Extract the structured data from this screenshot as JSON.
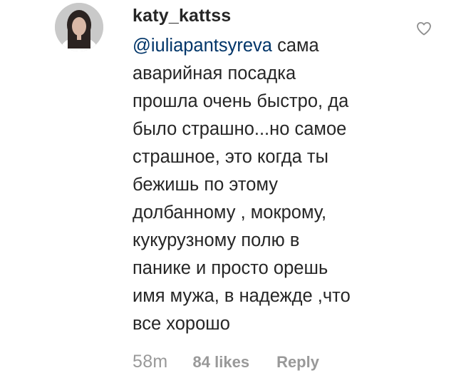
{
  "comment": {
    "username": "katy_kattss",
    "mention": "@iuliapantsyreva",
    "first_line_rest": " сама",
    "lines": [
      "аварийная посадка",
      "прошла очень быстро, да",
      "было страшно...но самое",
      "страшное, это когда ты",
      "бежишь по этому",
      "долбанному , мокрому,",
      "кукурузному полю в",
      "панике и просто орешь",
      "имя мужа, в надежде ,что",
      "все хорошо"
    ],
    "time": "58m",
    "likes": "84 likes",
    "reply": "Reply",
    "like_icon": "heart-outline-icon"
  },
  "colors": {
    "text": "#262626",
    "mention": "#003569",
    "meta": "#999999",
    "icon_stroke": "#8e8e8e"
  }
}
